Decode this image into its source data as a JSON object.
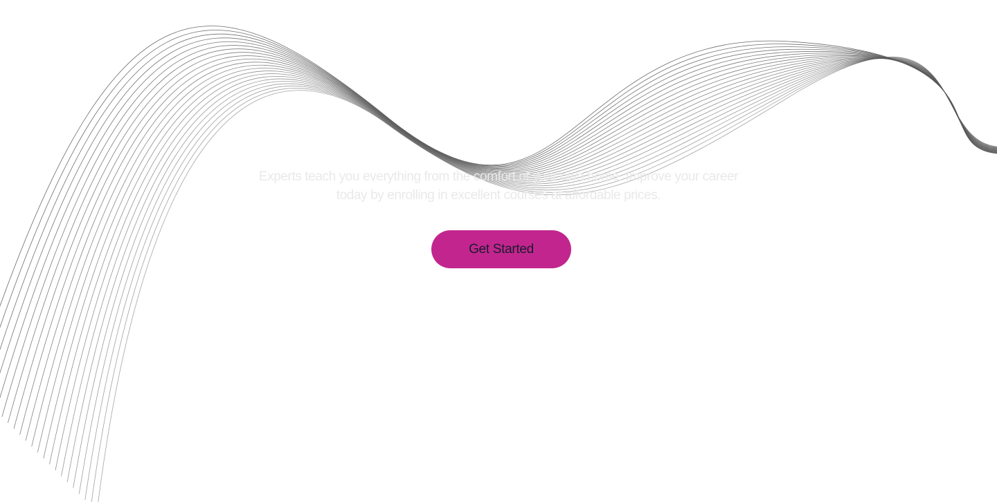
{
  "hero": {
    "headline_line_1": "",
    "headline_line_2": "",
    "subtitle_line_1": "Experts teach you everything from the comfort of your own home. Improve your career",
    "subtitle_line_2": "today by enrolling in excellent courses at affordable prices.",
    "cta_label": "Get Started"
  },
  "colors": {
    "background": "#ffffff",
    "wave_lines": "#5a5a5a",
    "cta_background": "#c2268e",
    "cta_text": "#1a1a2e",
    "subtitle_text": "#e9e9e9"
  }
}
